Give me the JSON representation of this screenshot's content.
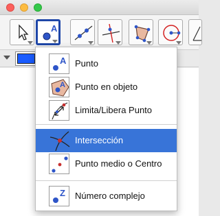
{
  "toolbar": {
    "tools": [
      {
        "icon": "move-arrow-icon"
      },
      {
        "icon": "point-tool-icon",
        "selected": true
      },
      {
        "icon": "line-tool-icon"
      },
      {
        "icon": "perpendicular-tool-icon"
      },
      {
        "icon": "polygon-tool-icon"
      },
      {
        "icon": "circle-tool-icon"
      },
      {
        "icon": "angle-tool-icon"
      }
    ]
  },
  "style_bar": {
    "color": "#1a5cff"
  },
  "menu": {
    "items": [
      {
        "label": "Punto",
        "icon": "point-icon"
      },
      {
        "label": "Punto en objeto",
        "icon": "point-on-object-icon"
      },
      {
        "label": "Limita/Libera Punto",
        "icon": "attach-detach-point-icon"
      },
      {
        "label": "Intersección",
        "icon": "intersection-icon",
        "highlighted": true
      },
      {
        "label": "Punto medio o Centro",
        "icon": "midpoint-icon"
      },
      {
        "label": "Número complejo",
        "icon": "complex-number-icon"
      }
    ]
  },
  "colors": {
    "accent": "#3874d8",
    "selected_border": "#1f47a8",
    "point_blue": "#2e55c8"
  }
}
